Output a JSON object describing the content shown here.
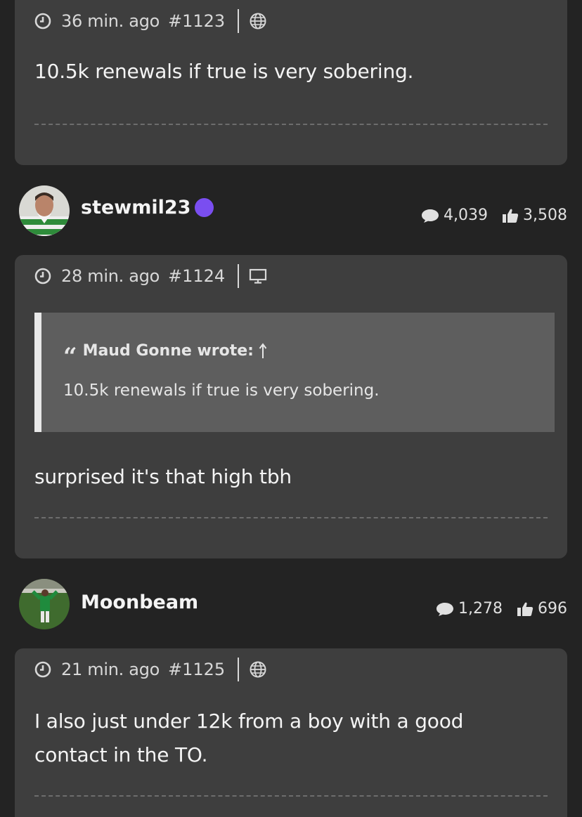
{
  "posts": [
    {
      "time": "36 min. ago",
      "number": "#1123",
      "device_icon": "globe-icon",
      "body": "10.5k renewals if true is very sobering."
    },
    {
      "time": "28 min. ago",
      "number": "#1124",
      "device_icon": "desktop-icon",
      "quote": {
        "author_line": "Maud Gonne wrote:",
        "text": "10.5k renewals if true is very sobering."
      },
      "body": "surprised it's that high  tbh"
    },
    {
      "time": "21 min. ago",
      "number": "#1125",
      "device_icon": "globe-icon",
      "body_line1": "I also just under 12k from a boy with a good",
      "body_line2": "contact in the TO."
    }
  ],
  "users": [
    {
      "name": "stewmil23",
      "online": true,
      "posts": "4,039",
      "likes": "3,508"
    },
    {
      "name": "Moonbeam",
      "online": false,
      "posts": "1,278",
      "likes": "696"
    }
  ],
  "colors": {
    "background": "#232323",
    "card": "#3e3e3e",
    "online_dot": "#7a4ef0"
  }
}
